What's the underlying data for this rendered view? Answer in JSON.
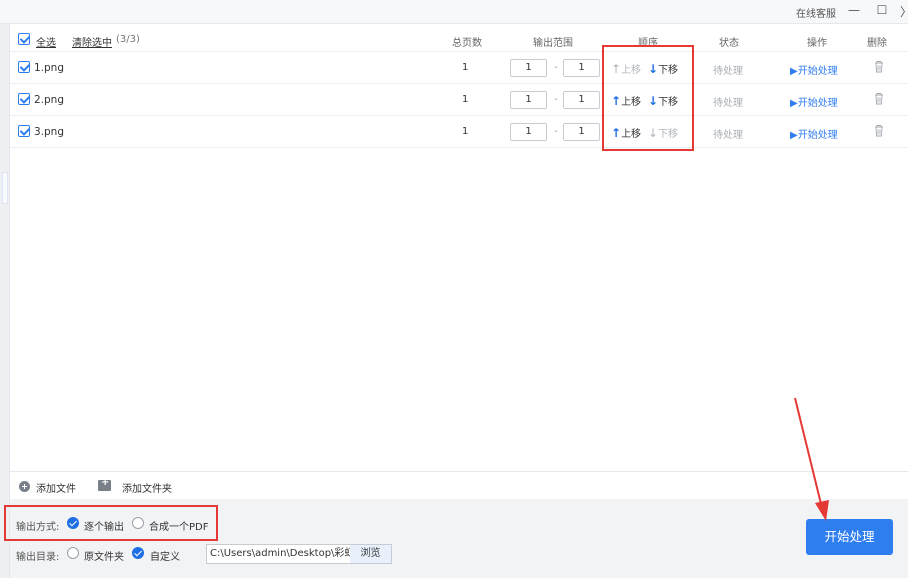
{
  "window": {
    "service_label": "在线客服",
    "minimize_glyph": "—",
    "maximize_glyph": "☐",
    "close_glyph": "〉"
  },
  "table": {
    "select_all_label": "全选",
    "clear_selected_label": "清除选中",
    "selected_count": "(3/3)",
    "columns": {
      "pages": "总页数",
      "range": "输出范围",
      "order": "顺序",
      "status": "状态",
      "action": "操作",
      "delete": "删除"
    },
    "range_separator": "-",
    "rows": [
      {
        "name": "1.png",
        "pages": "1",
        "range_from": "1",
        "range_to": "1",
        "move_up": "上移",
        "move_down": "下移",
        "up_enabled": false,
        "down_enabled": true,
        "status": "待处理",
        "action": "▶开始处理"
      },
      {
        "name": "2.png",
        "pages": "1",
        "range_from": "1",
        "range_to": "1",
        "move_up": "上移",
        "move_down": "下移",
        "up_enabled": true,
        "down_enabled": true,
        "status": "待处理",
        "action": "▶开始处理"
      },
      {
        "name": "3.png",
        "pages": "1",
        "range_from": "1",
        "range_to": "1",
        "move_up": "上移",
        "move_down": "下移",
        "up_enabled": true,
        "down_enabled": false,
        "status": "待处理",
        "action": "▶开始处理"
      }
    ]
  },
  "add_bar": {
    "add_file": "添加文件",
    "add_folder": "添加文件夹"
  },
  "output": {
    "mode_label": "输出方式:",
    "mode_single": "逐个输出",
    "mode_merge": "合成一个PDF",
    "mode_selected": "逐个输出",
    "dir_label": "输出目录:",
    "dir_original": "原文件夹",
    "dir_custom": "自定义",
    "dir_selected": "自定义",
    "path": "C:\\Users\\admin\\Desktop\\彩虹",
    "browse": "浏览"
  },
  "start_button": "开始处理",
  "icons": [
    "checkbox-icon",
    "arrow-up-icon",
    "arrow-down-icon",
    "trash-icon",
    "add-circle-icon",
    "folder-add-icon",
    "radio-checked-icon"
  ],
  "colors": {
    "accent": "#2f7ef0",
    "highlight": "#e53935",
    "disabled": "#b2b6bc"
  }
}
